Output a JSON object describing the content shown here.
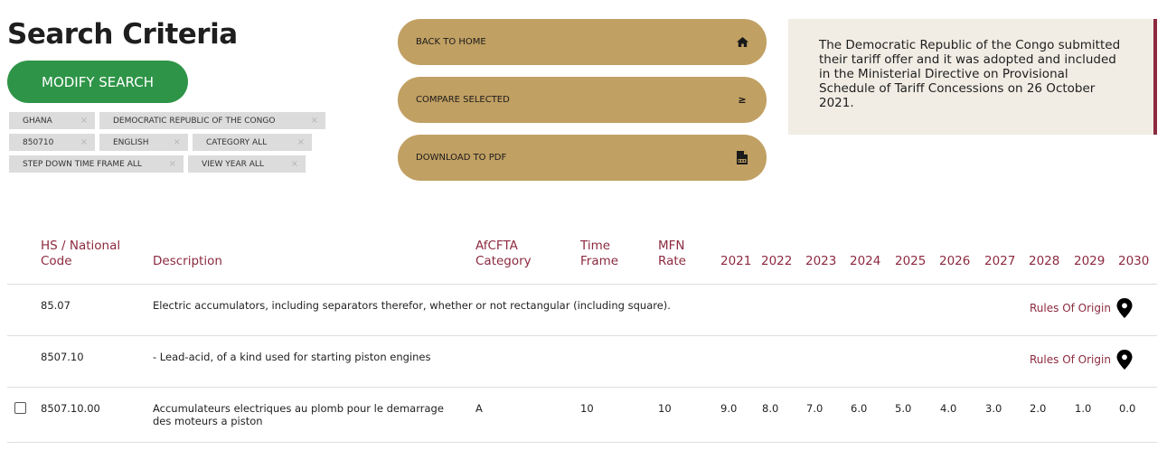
{
  "header": {
    "title": "Search Criteria",
    "modify_button": "MODIFY SEARCH"
  },
  "tags": [
    {
      "label": "GHANA"
    },
    {
      "label": "DEMOCRATIC REPUBLIC OF THE CONGO"
    },
    {
      "label": "850710"
    },
    {
      "label": "ENGLISH"
    },
    {
      "label": "CATEGORY ALL"
    },
    {
      "label": "STEP DOWN TIME FRAME ALL"
    },
    {
      "label": "VIEW YEAR ALL"
    }
  ],
  "tag_close_glyph": "×",
  "actions": {
    "back_home": {
      "label": "BACK TO HOME",
      "icon": "home-icon"
    },
    "compare": {
      "label": "COMPARE SELECTED",
      "icon": "greater-equal-icon",
      "glyph": "≥"
    },
    "download": {
      "label": "DOWNLOAD TO PDF",
      "icon": "pdf-file-icon"
    }
  },
  "notice": {
    "text": "The Democratic Republic of the Congo submitted their tariff offer and it was adopted and included in the Ministerial Directive on Provisional Schedule of Tariff Concessions on 26 October 2021."
  },
  "table": {
    "headers": {
      "hs_line1": "HS / National",
      "hs_line2": "Code",
      "description": "Description",
      "afcfta_line1": "AfCFTA",
      "afcfta_line2": "Category",
      "time_line1": "Time",
      "time_line2": "Frame",
      "mfn_line1": "MFN",
      "mfn_line2": "Rate",
      "years": [
        "2021",
        "2022",
        "2023",
        "2024",
        "2025",
        "2026",
        "2027",
        "2028",
        "2029",
        "2030"
      ]
    },
    "rows": [
      {
        "code": "85.07",
        "description": "Electric accumulators, including separators therefor, whether or not rectangular (including square).",
        "rules_link": "Rules Of Origin"
      },
      {
        "code": "8507.10",
        "description": "- Lead-acid, of a kind used for starting piston engines",
        "rules_link": "Rules Of Origin"
      },
      {
        "code": "8507.10.00",
        "description_line1": "Accumulateurs electriques au plomb pour le demarrage",
        "description_line2": "des moteurs a piston",
        "category": "A",
        "time_frame": "10",
        "mfn_rate": "10",
        "rates": [
          "9.0",
          "8.0",
          "7.0",
          "6.0",
          "5.0",
          "4.0",
          "3.0",
          "2.0",
          "1.0",
          "0.0"
        ],
        "checked": false
      }
    ]
  },
  "colors": {
    "accent_green": "#2e9447",
    "gold_button": "#c1a063",
    "maroon": "#8c2a3f",
    "notice_bg": "#f1ede4",
    "tag_bg": "#dcdcdc"
  }
}
